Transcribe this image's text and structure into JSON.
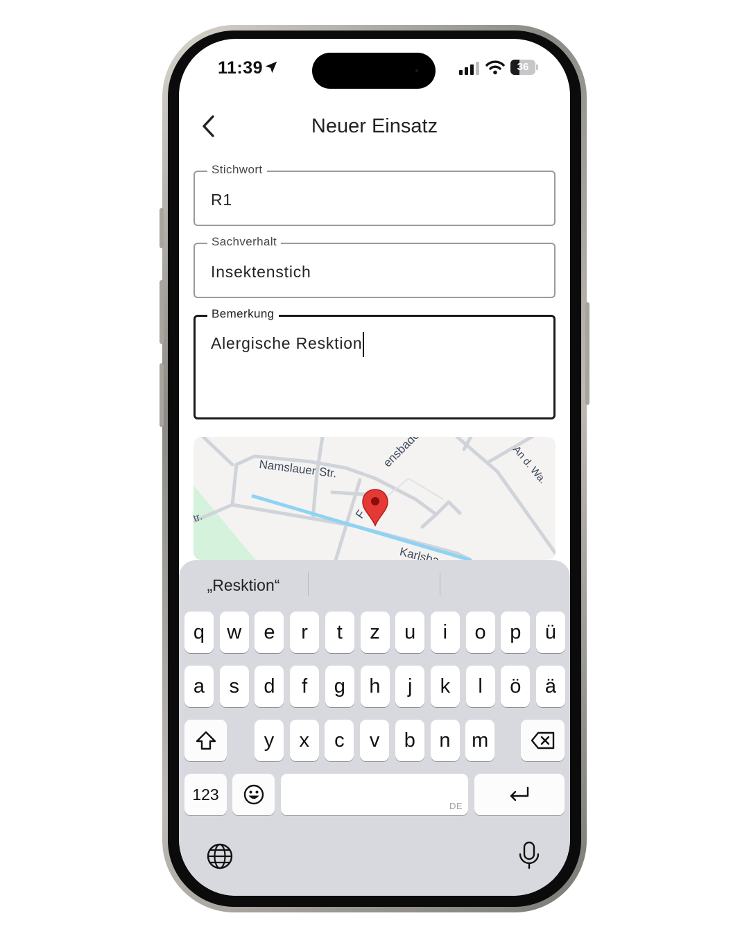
{
  "status_bar": {
    "time": "11:39",
    "battery_level": 36,
    "battery_text": "36",
    "icons": [
      "location-arrow-icon",
      "cellular-signal-icon",
      "wifi-icon",
      "battery-icon"
    ]
  },
  "nav": {
    "back_icon": "chevron-left-icon",
    "title": "Neuer Einsatz"
  },
  "form": {
    "stichwort": {
      "label": "Stichwort",
      "value": "R1"
    },
    "sachverhalt": {
      "label": "Sachverhalt",
      "value": "Insektenstich"
    },
    "bemerkung": {
      "label": "Bemerkung",
      "value": "Alergische Resktion"
    }
  },
  "map": {
    "streets": [
      "Namslauer Str.",
      "F",
      "ensbader Str.",
      "tr.",
      "An d. Wa.",
      "Karlsba"
    ],
    "marker_icon": "map-pin-icon"
  },
  "keyboard": {
    "suggestions": [
      "„Resktion“",
      "",
      ""
    ],
    "row1": [
      "q",
      "w",
      "e",
      "r",
      "t",
      "z",
      "u",
      "i",
      "o",
      "p",
      "ü"
    ],
    "row2": [
      "a",
      "s",
      "d",
      "f",
      "g",
      "h",
      "j",
      "k",
      "l",
      "ö",
      "ä"
    ],
    "row3": [
      "y",
      "x",
      "c",
      "v",
      "b",
      "n",
      "m"
    ],
    "numbers_label": "123",
    "space_hint": "DE",
    "icons": [
      "shift-icon",
      "backspace-icon",
      "emoji-icon",
      "return-icon",
      "globe-icon",
      "microphone-icon"
    ]
  },
  "colors": {
    "marker": "#e53935",
    "route": "#8fd3f4",
    "park": "#d4f2dc",
    "keyboard_bg": "#d8d9de"
  }
}
